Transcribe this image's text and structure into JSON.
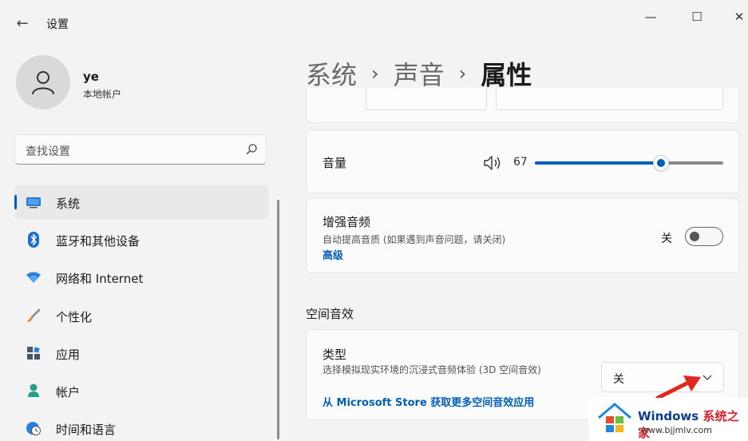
{
  "window": {
    "app_title": "设置",
    "back_glyph": "←",
    "minimize_glyph": "—",
    "maximize_glyph": "☐",
    "close_glyph": "✕"
  },
  "profile": {
    "name": "ye",
    "account_type": "本地帐户"
  },
  "search": {
    "placeholder": "查找设置"
  },
  "sidebar": {
    "items": [
      {
        "label": "系统",
        "icon": "monitor-icon",
        "active": true
      },
      {
        "label": "蓝牙和其他设备",
        "icon": "bluetooth-icon"
      },
      {
        "label": "网络和 Internet",
        "icon": "wifi-icon"
      },
      {
        "label": "个性化",
        "icon": "brush-icon"
      },
      {
        "label": "应用",
        "icon": "apps-icon"
      },
      {
        "label": "帐户",
        "icon": "person-icon"
      },
      {
        "label": "时间和语言",
        "icon": "clock-globe-icon"
      }
    ]
  },
  "breadcrumb": {
    "items": [
      "系统",
      "声音"
    ],
    "current": "属性",
    "separator": "›"
  },
  "volume": {
    "label": "音量",
    "value": "67",
    "level": 0.67
  },
  "enhance_audio": {
    "title": "增强音频",
    "description": "自动提高音质 (如果遇到声音问题，请关闭)",
    "link": "高级",
    "toggle_label": "关",
    "toggle_on": false
  },
  "spatial": {
    "section_title": "空间音效",
    "type_title": "类型",
    "type_description": "选择模拟现实环境的沉浸式音频体验 (3D 空间音效)",
    "store_link": "从 Microsoft Store 获取更多空间音效应用",
    "dropdown_value": "关"
  },
  "watermark": {
    "brand": "Windows",
    "brand_accent": "系统之家",
    "url": "www.bjjmlv.com"
  },
  "colors": {
    "accent": "#005fb8",
    "annotation_arrow": "#e02a20"
  }
}
